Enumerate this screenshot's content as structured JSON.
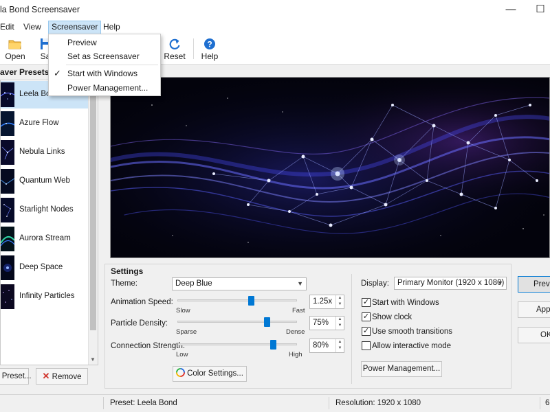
{
  "window": {
    "title": "la Bond Screensaver",
    "minimize_glyph": "—",
    "maximize_glyph": "☐"
  },
  "menu": {
    "edit": "Edit",
    "view": "View",
    "screensaver": "Screensaver",
    "help": "Help"
  },
  "toolbar": {
    "open": "Open",
    "save": "Sa",
    "reset": "Reset",
    "help": "Help"
  },
  "dropdown": {
    "items": [
      "Preview",
      "Set as Screensaver",
      "Start with Windows",
      "Power Management..."
    ],
    "checked": "✓"
  },
  "presets": {
    "header": "aver Presets",
    "items": [
      "Leela Bond",
      "Azure Flow",
      "Nebula Links",
      "Quantum Web",
      "Starlight Nodes",
      "Aurora Stream",
      "Deep Space",
      "Infinity Particles"
    ],
    "add_label": "l Preset...",
    "remove_label": "Remove"
  },
  "settings": {
    "title": "Settings",
    "theme_label": "Theme:",
    "theme_value": "Deep Blue",
    "animation_speed_label": "Animation Speed:",
    "animation_speed_value": "1.25x",
    "animation_speed_level": 0.62,
    "slow": "Slow",
    "fast": "Fast",
    "particle_density_label": "Particle Density:",
    "particle_density_value": "75%",
    "particle_density_level": 0.75,
    "sparse": "Sparse",
    "dense": "Dense",
    "connection_strength_label": "Connection Strength:",
    "connection_strength_value": "80%",
    "connection_strength_level": 0.8,
    "low": "Low",
    "high": "High",
    "color_settings": "Color Settings...",
    "display_label": "Display:",
    "display_value": "Primary Monitor (1920 x 1080)",
    "checkboxes": [
      {
        "label": "Start with Windows",
        "checked": true
      },
      {
        "label": "Show clock",
        "checked": true
      },
      {
        "label": "Use smooth transitions",
        "checked": true
      },
      {
        "label": "Allow interactive mode",
        "checked": false
      }
    ],
    "check_glyph": "✓",
    "power_management": "Power Management..."
  },
  "side_buttons": {
    "preview": "Previ",
    "apply": "App",
    "ok": "OK"
  },
  "status": {
    "preset": "Preset: Leela Bond",
    "resolution": "Resolution: 1920 x 1080",
    "extra": "6"
  },
  "icons": {
    "open": "folder-icon",
    "save": "save-icon",
    "reset": "refresh-icon",
    "help": "help-icon",
    "remove": "remove-x-icon",
    "color": "color-wheel-icon"
  },
  "colors": {
    "accent": "#0078d4",
    "selection": "#cce4f7",
    "remove_red": "#d0342c"
  }
}
